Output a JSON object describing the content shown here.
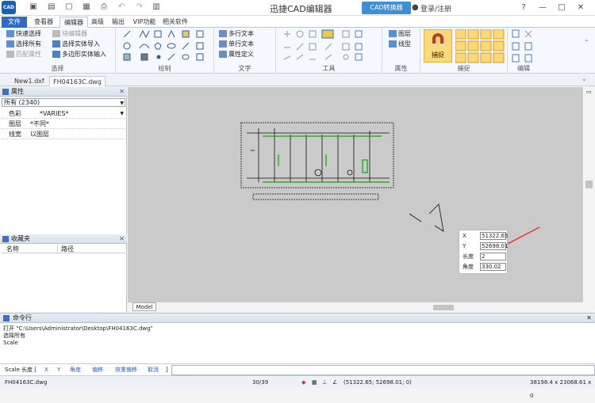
{
  "app": {
    "logo_text": "CAD",
    "title": "迅捷CAD编辑器",
    "converter_button": "CAD转换器",
    "login": "登录/注册"
  },
  "tabs": [
    {
      "label": "文件"
    },
    {
      "label": "查看器"
    },
    {
      "label": "编辑器"
    },
    {
      "label": "高级"
    },
    {
      "label": "输出"
    },
    {
      "label": "VIP功能"
    },
    {
      "label": "相关软件"
    }
  ],
  "ribbon": {
    "select": {
      "label": "选择",
      "buttons": [
        "快速选择",
        "选择所有",
        "匹配属性",
        "块编辑器",
        "选择实体导入",
        "多边形实体输入"
      ]
    },
    "draw": {
      "label": "绘制"
    },
    "text": {
      "label": "文字",
      "buttons": [
        "多行文本",
        "单行文本",
        "属性定义"
      ]
    },
    "tools": {
      "label": "工具"
    },
    "properties": {
      "label": "属性",
      "buttons": [
        "图层",
        "线型"
      ]
    },
    "snap": {
      "label": "捕捉",
      "button": "捕捉"
    },
    "edit": {
      "label": "编辑"
    }
  },
  "documents": [
    {
      "name": "New1.dxf"
    },
    {
      "name": "FH04163C.dwg",
      "active": true
    }
  ],
  "properties_panel": {
    "title": "属性",
    "selection": "所有 (2340)",
    "rows": [
      {
        "key": "色彩",
        "value": "*VARIES*"
      },
      {
        "key": "图层",
        "value": "*不同*"
      },
      {
        "key": "线宽",
        "value": "以图层"
      }
    ]
  },
  "favorites_panel": {
    "title": "收藏夹",
    "columns": [
      "名称",
      "路径"
    ]
  },
  "canvas": {
    "model_tab": "Model"
  },
  "coord_tip": [
    {
      "label": "X",
      "value": "51322.65"
    },
    {
      "label": "Y",
      "value": "52698.01"
    },
    {
      "label": "长度",
      "value": "2"
    },
    {
      "label": "角度",
      "value": "330.02"
    }
  ],
  "command": {
    "title": "命令行",
    "history": [
      "打开 \"C:\\Users\\Administrator\\Desktop\\FH04163C.dwg\"",
      "选择所有",
      "Scale"
    ],
    "prompt": "Scale  长度  [",
    "options": [
      "X",
      "Y",
      "角度",
      "偏移",
      "效重偏移",
      "取消"
    ],
    "prompt_end": "]"
  },
  "status": {
    "file": "FH04163C.dwg",
    "page": "30/39",
    "coords": "(51322.65; 52698.01; 0)",
    "size": "38198.4 x 23068.61 x 0"
  },
  "colors": {
    "accent": "#2f6cc1",
    "canvas": "#cacaca",
    "drawing_green": "#00b000",
    "arrow": "#e5392a"
  }
}
